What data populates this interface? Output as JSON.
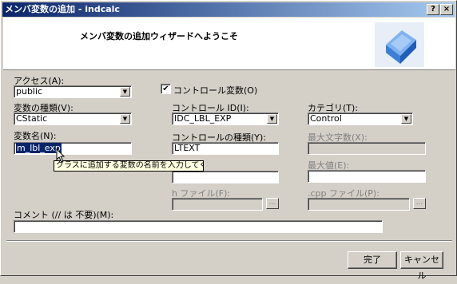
{
  "window": {
    "title": "メンバ変数の追加 - indcalc",
    "help_label": "?",
    "close_label": "×"
  },
  "header": {
    "title": "メンバ変数の追加ウィザードへようこそ",
    "logo": "wizard-cube-icon"
  },
  "access": {
    "label": "アクセス(A):",
    "value": "public"
  },
  "control_var": {
    "label": "コントロール変数(O)",
    "checked": true,
    "mark": "✔"
  },
  "var_type": {
    "label": "変数の種類(V):",
    "value": "CStatic"
  },
  "control_id": {
    "label": "コントロール ID(I):",
    "value": "IDC_LBL_EXP"
  },
  "category": {
    "label": "カテゴリ(T):",
    "value": "Control"
  },
  "var_name": {
    "label": "変数名(N):",
    "value": "m_lbl_exp"
  },
  "control_type": {
    "label": "コントロールの種類(Y):",
    "value": "LTEXT"
  },
  "max_chars": {
    "label": "最大文字数(X):",
    "value": ""
  },
  "min_value": {
    "value": ""
  },
  "max_value": {
    "label": "最大値(E):",
    "value": ""
  },
  "h_file": {
    "label": "h ファイル(F):",
    "value": "",
    "browse": "..."
  },
  "cpp_file": {
    "label": ".cpp ファイル(P):",
    "value": "",
    "browse": "..."
  },
  "comment": {
    "label": "コメント (// は 不要)(M):",
    "value": ""
  },
  "tooltip": {
    "text": "クラスに追加する変数の名前を入力してください。"
  },
  "buttons": {
    "finish": "完了",
    "cancel": "キャンセル"
  },
  "dropdown_glyph": "▼"
}
